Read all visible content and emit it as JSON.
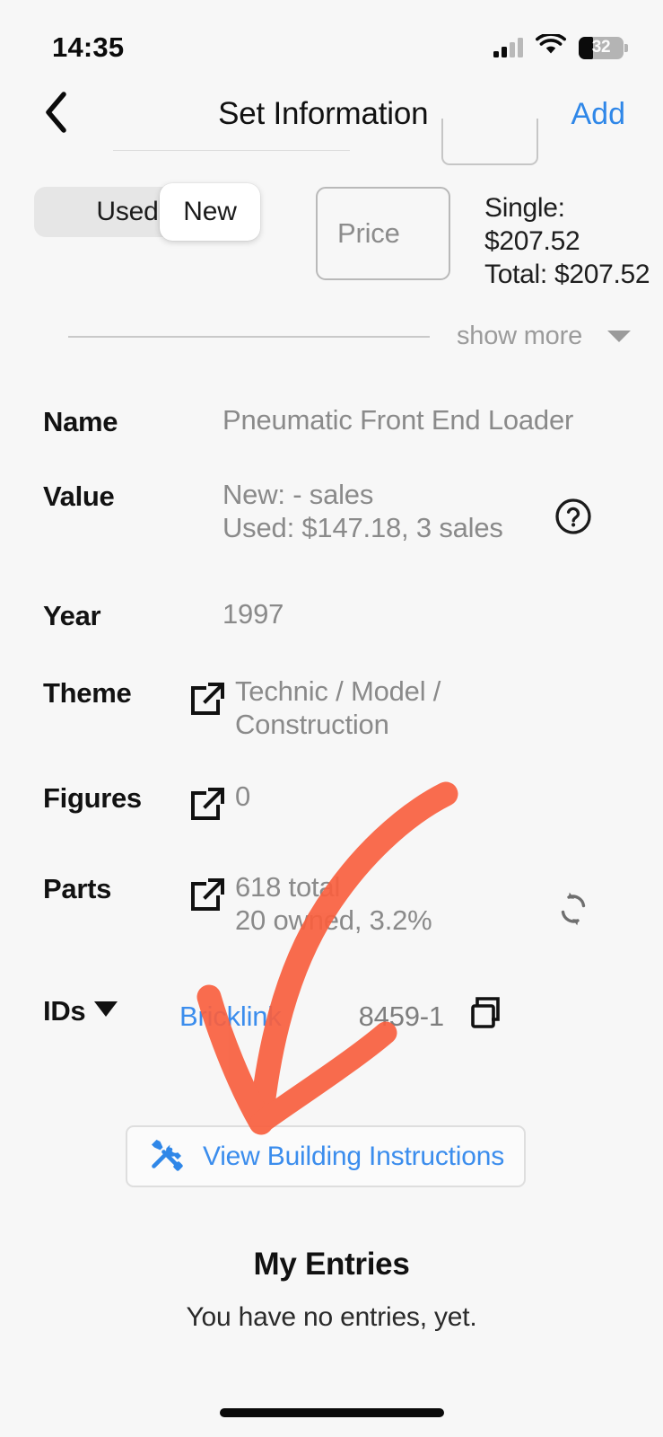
{
  "status_bar": {
    "time": "14:35",
    "cellular_icon": "cellular-signal-icon",
    "wifi_icon": "wifi-icon",
    "battery_icon": "battery-icon",
    "battery_percent": "32",
    "battery_level": 32
  },
  "nav": {
    "back_icon": "chevron-left-icon",
    "title": "Set Information",
    "add_label": "Add"
  },
  "condition": {
    "options": [
      "Used",
      "New"
    ],
    "used_label": "Used",
    "new_label": "New",
    "selected": "New"
  },
  "price": {
    "placeholder": "Price",
    "value": "",
    "single_line": "Single:",
    "single_amount": "$207.52",
    "total_line": "Total: $207.52"
  },
  "show_more": {
    "label": "show more",
    "caret_icon": "chevron-down-icon"
  },
  "info_rows": {
    "name": {
      "label": "Name",
      "value": "Pneumatic Front End Loader"
    },
    "value": {
      "label": "Value",
      "line1": "New: - sales",
      "line2": "Used: $147.18, 3 sales",
      "help_icon": "question-circle-icon"
    },
    "year": {
      "label": "Year",
      "value": "1997"
    },
    "theme": {
      "label": "Theme",
      "link_icon": "external-link-icon",
      "line1": "Technic / Model /",
      "line2": "Construction"
    },
    "figures": {
      "label": "Figures",
      "link_icon": "external-link-icon",
      "value": "0"
    },
    "parts": {
      "label": "Parts",
      "link_icon": "external-link-icon",
      "line1": "618 total",
      "line2": "20 owned, 3.2%",
      "refresh_icon": "refresh-sync-icon"
    },
    "ids": {
      "label": "IDs",
      "caret_icon": "caret-down-icon",
      "source": "Bricklink",
      "id_value": "8459-1",
      "copy_icon": "copy-icon"
    }
  },
  "instructions_button": {
    "icon": "tools-hammer-wrench-icon",
    "label": "View Building Instructions"
  },
  "my_entries": {
    "title": "My Entries",
    "empty_text": "You have no entries, yet."
  },
  "annotation": {
    "shape": "hand-drawn-arrow",
    "color": "#f9603f"
  },
  "colors": {
    "background": "#f7f7f7",
    "accent_blue": "#3b8ded",
    "label_text": "#121212",
    "value_text": "#8a8a8a",
    "annotation_red": "#f9603f"
  }
}
